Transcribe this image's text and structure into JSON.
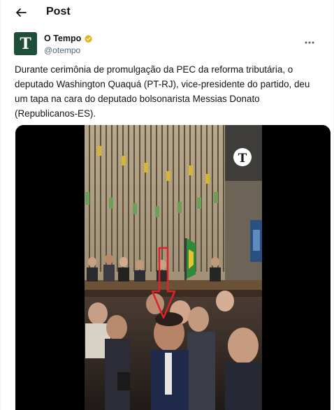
{
  "header": {
    "title": "Post",
    "back_icon": "arrow-left-icon"
  },
  "author": {
    "avatar_letter": "T",
    "avatar_color": "#1e4e3a",
    "name": "O Tempo",
    "handle": "@otempo",
    "verified_icon": "verified-badge-icon",
    "verified_color": "#e2b719",
    "more_icon": "more-icon"
  },
  "tweet": {
    "text": "Durante cerimônia de promulgação da PEC da reforma tributária, o deputado Washington Quaquá (PT-RJ), vice-presidente do partido, deu um tapa na cara do deputado bolsonarista Messias Donato (Republicanos-ES)."
  },
  "media": {
    "watermark_letter": "T",
    "arrow_color": "#e0202a"
  }
}
